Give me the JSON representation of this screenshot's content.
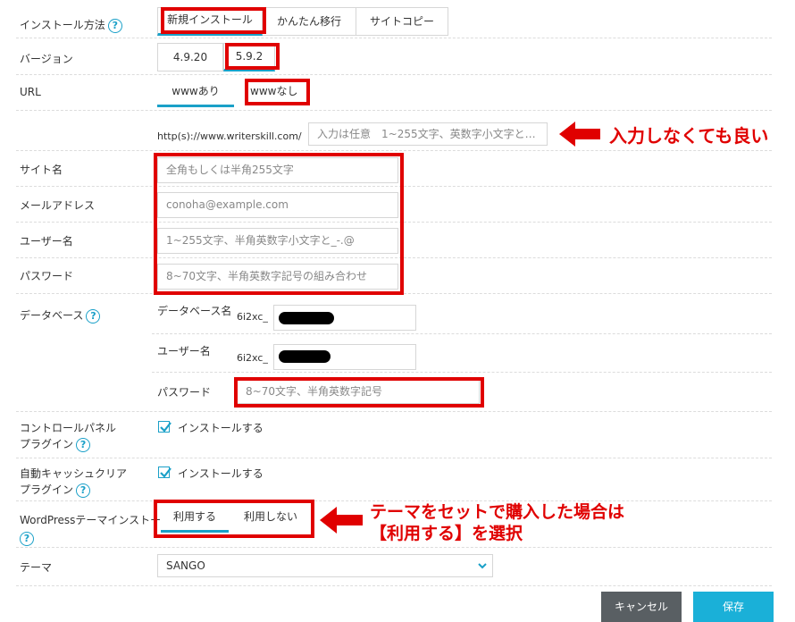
{
  "install_method": {
    "label": "インストール方法",
    "options": [
      "新規インストール",
      "かんたん移行",
      "サイトコピー"
    ]
  },
  "version": {
    "label": "バージョン",
    "options": [
      "4.9.20",
      "5.9.2"
    ]
  },
  "url": {
    "label": "URL",
    "options": [
      "wwwあり",
      "wwwなし"
    ],
    "prefix": "http(s)://www.writerskill.com/",
    "path_placeholder": "入力は任意　1~255文字、英数字小文字と…"
  },
  "site_name": {
    "label": "サイト名",
    "placeholder": "全角もしくは半角255文字"
  },
  "email": {
    "label": "メールアドレス",
    "placeholder": "conoha@example.com"
  },
  "username": {
    "label": "ユーザー名",
    "placeholder": "1~255文字、半角英数字小文字と_-.@"
  },
  "password": {
    "label": "パスワード",
    "placeholder": "8~70文字、半角英数字記号の組み合わせ"
  },
  "database": {
    "label": "データベース",
    "name_label": "データベース名",
    "name_prefix": "6i2xc_",
    "user_label": "ユーザー名",
    "user_prefix": "6i2xc_",
    "password_label": "パスワード",
    "password_placeholder": "8~70文字、半角英数字記号"
  },
  "cp_plugin": {
    "label_line1": "コントロールパネル",
    "label_line2": "プラグイン",
    "checkbox_label": "インストールする",
    "checked": true
  },
  "cache_plugin": {
    "label_line1": "自動キャッシュクリア",
    "label_line2": "プラグイン",
    "checkbox_label": "インストールする",
    "checked": true
  },
  "theme_install": {
    "label": "WordPressテーマインストール",
    "options": [
      "利用する",
      "利用しない"
    ]
  },
  "theme": {
    "label": "テーマ",
    "selected": "SANGO"
  },
  "buttons": {
    "cancel": "キャンセル",
    "save": "保存"
  },
  "annotations": {
    "url_note": "入力しなくても良い",
    "theme_note_line1": "テーマをセットで購入した場合は",
    "theme_note_line2": "【利用する】を選択"
  },
  "help_glyph": "?",
  "colors": {
    "accent": "#1aa0c8",
    "annotation_red": "#e00000",
    "cancel_bg": "#595f63",
    "save_bg": "#1ab0d8"
  }
}
